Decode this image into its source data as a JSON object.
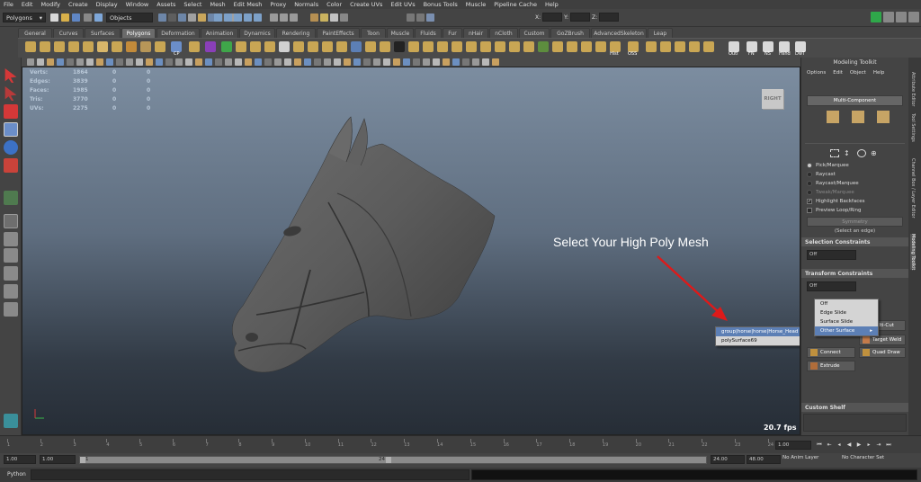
{
  "menu": [
    "File",
    "Edit",
    "Modify",
    "Create",
    "Display",
    "Window",
    "Assets",
    "Select",
    "Mesh",
    "Edit Mesh",
    "Proxy",
    "Normals",
    "Color",
    "Create UVs",
    "Edit UVs",
    "Bonus Tools",
    "Muscle",
    "Pipeline Cache",
    "Help"
  ],
  "status": {
    "mode": "Polygons",
    "select_by": "Objects",
    "x_label": "X:",
    "y_label": "Y:",
    "z_label": "Z:"
  },
  "shelf_tabs": [
    "General",
    "Curves",
    "Surfaces",
    "Polygons",
    "Deformation",
    "Animation",
    "Dynamics",
    "Rendering",
    "PaintEffects",
    "Toon",
    "Muscle",
    "Fluids",
    "Fur",
    "nHair",
    "nCloth",
    "Custom",
    "GoZBrush",
    "AdvancedSkeleton",
    "Leap"
  ],
  "shelf_active": "Polygons",
  "shelf_labels": {
    "cp": "CP",
    "hist": "Hist",
    "oss": "OSS",
    "outl": "Outl",
    "fn": "FN",
    "ns": "NS",
    "hshd": "Hshd",
    "dwt": "DwT"
  },
  "hud": [
    {
      "label": "Verts:",
      "values": [
        "1864",
        "0",
        "0"
      ]
    },
    {
      "label": "Edges:",
      "values": [
        "3839",
        "0",
        "0"
      ]
    },
    {
      "label": "Faces:",
      "values": [
        "1985",
        "0",
        "0"
      ]
    },
    {
      "label": "Tris:",
      "values": [
        "3770",
        "0",
        "0"
      ]
    },
    {
      "label": "UVs:",
      "values": [
        "2275",
        "0",
        "0"
      ]
    }
  ],
  "viewport": {
    "camera_label": "RIGHT",
    "callout": "Select Your High Poly Mesh",
    "fps": "20.7 fps"
  },
  "mesh_popup": {
    "items": [
      "group|horse|horse|Horse_Head",
      "polySurface69"
    ],
    "selected": 0
  },
  "slide_popup": {
    "items": [
      "Off",
      "Edge Slide",
      "Surface Slide",
      "Other Surface"
    ],
    "selected": 3
  },
  "toolkit": {
    "title": "Modeling Toolkit",
    "menu": [
      "Options",
      "Edit",
      "Object",
      "Help"
    ],
    "mode": "Multi-Component",
    "select_options": [
      {
        "label": "Pick/Marquee",
        "state": "on"
      },
      {
        "label": "Raycast",
        "state": "off"
      },
      {
        "label": "Raycast/Marquee",
        "state": "off"
      },
      {
        "label": "Tweak/Marquee",
        "state": "dim"
      }
    ],
    "highlight_backfaces": "Highlight Backfaces",
    "preview_loop": "Preview Loop/Ring",
    "symmetry": "Symmetry",
    "select_edge": "(Select an edge)",
    "selection_constraints": "Selection Constraints",
    "sc_value": "Off",
    "transform_constraints": "Transform Constraints",
    "tc_value": "Off",
    "tools": {
      "multicut": "Multi-Cut",
      "target_weld": "Target Weld",
      "connect": "Connect",
      "quad_draw": "Quad Draw",
      "extrude": "Extrude"
    },
    "custom_shelf": "Custom Shelf"
  },
  "side_tabs": [
    "Attribute Editor",
    "Tool Settings",
    "Channel Box / Layer Editor",
    "Modeling Toolkit"
  ],
  "timeline": {
    "ticks": [
      "1",
      "2",
      "3",
      "4",
      "5",
      "6",
      "7",
      "8",
      "9",
      "10",
      "11",
      "12",
      "13",
      "14",
      "15",
      "16",
      "17",
      "18",
      "19",
      "20",
      "21",
      "22",
      "23",
      "24"
    ],
    "current": "1.00"
  },
  "range": {
    "start": "1.00",
    "start2": "1.00",
    "slider_start": "1",
    "slider_end": "24",
    "end": "24.00",
    "end2": "48.00",
    "anim_layer": "No Anim Layer",
    "char_set": "No Character Set"
  },
  "cmd": {
    "label": "Python"
  },
  "colors": {
    "accent": "#5c7fb5",
    "arrow": "#dd1a1a",
    "viewport_top": "#7c8da0",
    "viewport_bottom": "#262d36"
  }
}
